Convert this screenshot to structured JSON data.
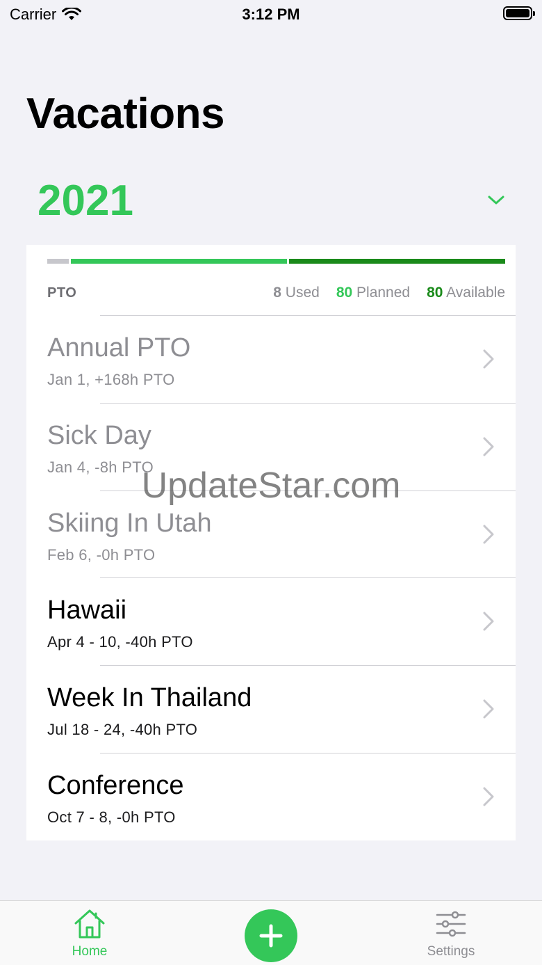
{
  "status_bar": {
    "carrier": "Carrier",
    "time": "3:12 PM"
  },
  "page": {
    "title": "Vacations",
    "year": "2021"
  },
  "pto": {
    "label": "PTO",
    "used_value": "8",
    "used_label": "Used",
    "planned_value": "80",
    "planned_label": "Planned",
    "available_value": "80",
    "available_label": "Available"
  },
  "vacations": [
    {
      "title": "Annual PTO",
      "subtitle": "Jan 1, +168h PTO",
      "state": "past"
    },
    {
      "title": "Sick Day",
      "subtitle": "Jan 4, -8h PTO",
      "state": "past"
    },
    {
      "title": "Skiing In Utah",
      "subtitle": "Feb 6, -0h PTO",
      "state": "past"
    },
    {
      "title": "Hawaii",
      "subtitle": "Apr 4 - 10, -40h PTO",
      "state": "future"
    },
    {
      "title": "Week In Thailand",
      "subtitle": "Jul 18 - 24, -40h PTO",
      "state": "future"
    },
    {
      "title": "Conference",
      "subtitle": "Oct 7 - 8, -0h PTO",
      "state": "future"
    }
  ],
  "watermark": "UpdateStar.com",
  "tab_bar": {
    "home_label": "Home",
    "settings_label": "Settings",
    "home_icon": "house-icon",
    "add_icon": "plus-icon",
    "settings_icon": "sliders-icon"
  },
  "colors": {
    "accent": "#34c759",
    "available": "#1a8a1a",
    "used": "#c7c7cc",
    "muted": "#8e8e93"
  }
}
